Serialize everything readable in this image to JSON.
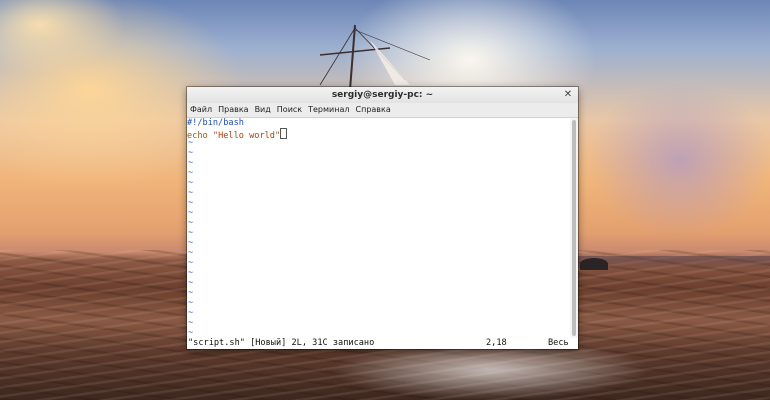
{
  "window": {
    "title": "sergiy@sergiy-pc: ~",
    "close_icon": "close-icon"
  },
  "menubar": {
    "items": [
      "Файл",
      "Правка",
      "Вид",
      "Поиск",
      "Терминал",
      "Справка"
    ]
  },
  "editor": {
    "lines": [
      "#!/bin/bash",
      "echo \"Hello world\""
    ],
    "empty_line_marker": "~"
  },
  "statusline": {
    "message": "\"script.sh\" [Новый] 2L, 31C записано",
    "position": "2,18",
    "scroll": "Весь"
  }
}
